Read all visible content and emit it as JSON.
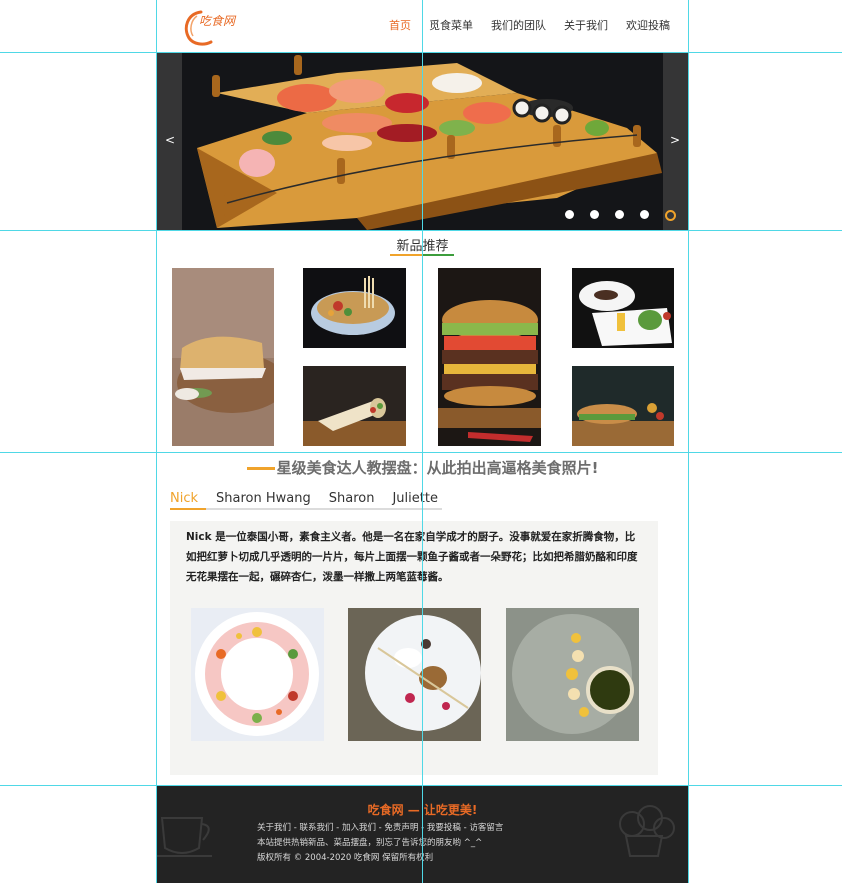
{
  "header": {
    "logo_text": "吃食网",
    "nav": [
      "首页",
      "觅食菜单",
      "我们的团队",
      "关于我们",
      "欢迎投稿"
    ],
    "nav_active": 0
  },
  "banner": {
    "prev_label": "<",
    "next_label": ">",
    "slide_count": 5,
    "active_slide": 4
  },
  "new_products": {
    "title": "新品推荐"
  },
  "team": {
    "title": "星级美食达人教摆盘：从此拍出高逼格美食照片!",
    "tabs": [
      "Nick",
      "Sharon Hwang",
      "Sharon",
      "Juliette"
    ],
    "active_tab": 0,
    "description": "Nick 是一位泰国小哥，素食主义者。他是一名在家自学成才的厨子。没事就爱在家折腾食物，比如把红萝卜切成几乎透明的一片片，每片上面摆一颗鱼子酱或者一朵野花；比如把希腊奶酪和印度无花果摆在一起，碾碎杏仁，泼墨一样撒上两笔蓝莓酱。"
  },
  "footer": {
    "title": "吃食网 — 让吃更美!",
    "links": "关于我们 - 联系我们 - 加入我们 - 免责声明 - 我要投稿 - 访客留言",
    "notice": "本站提供热销新品、菜品摆盘，别忘了告诉您的朋友哟 ^_^",
    "copyright": "版权所有 © 2004-2020 吃食网 保留所有权利"
  },
  "colors": {
    "accent": "#e86a25",
    "accent_yellow": "#f0a32b",
    "footer_bg": "#232323",
    "guide": "#4fd8e6"
  }
}
